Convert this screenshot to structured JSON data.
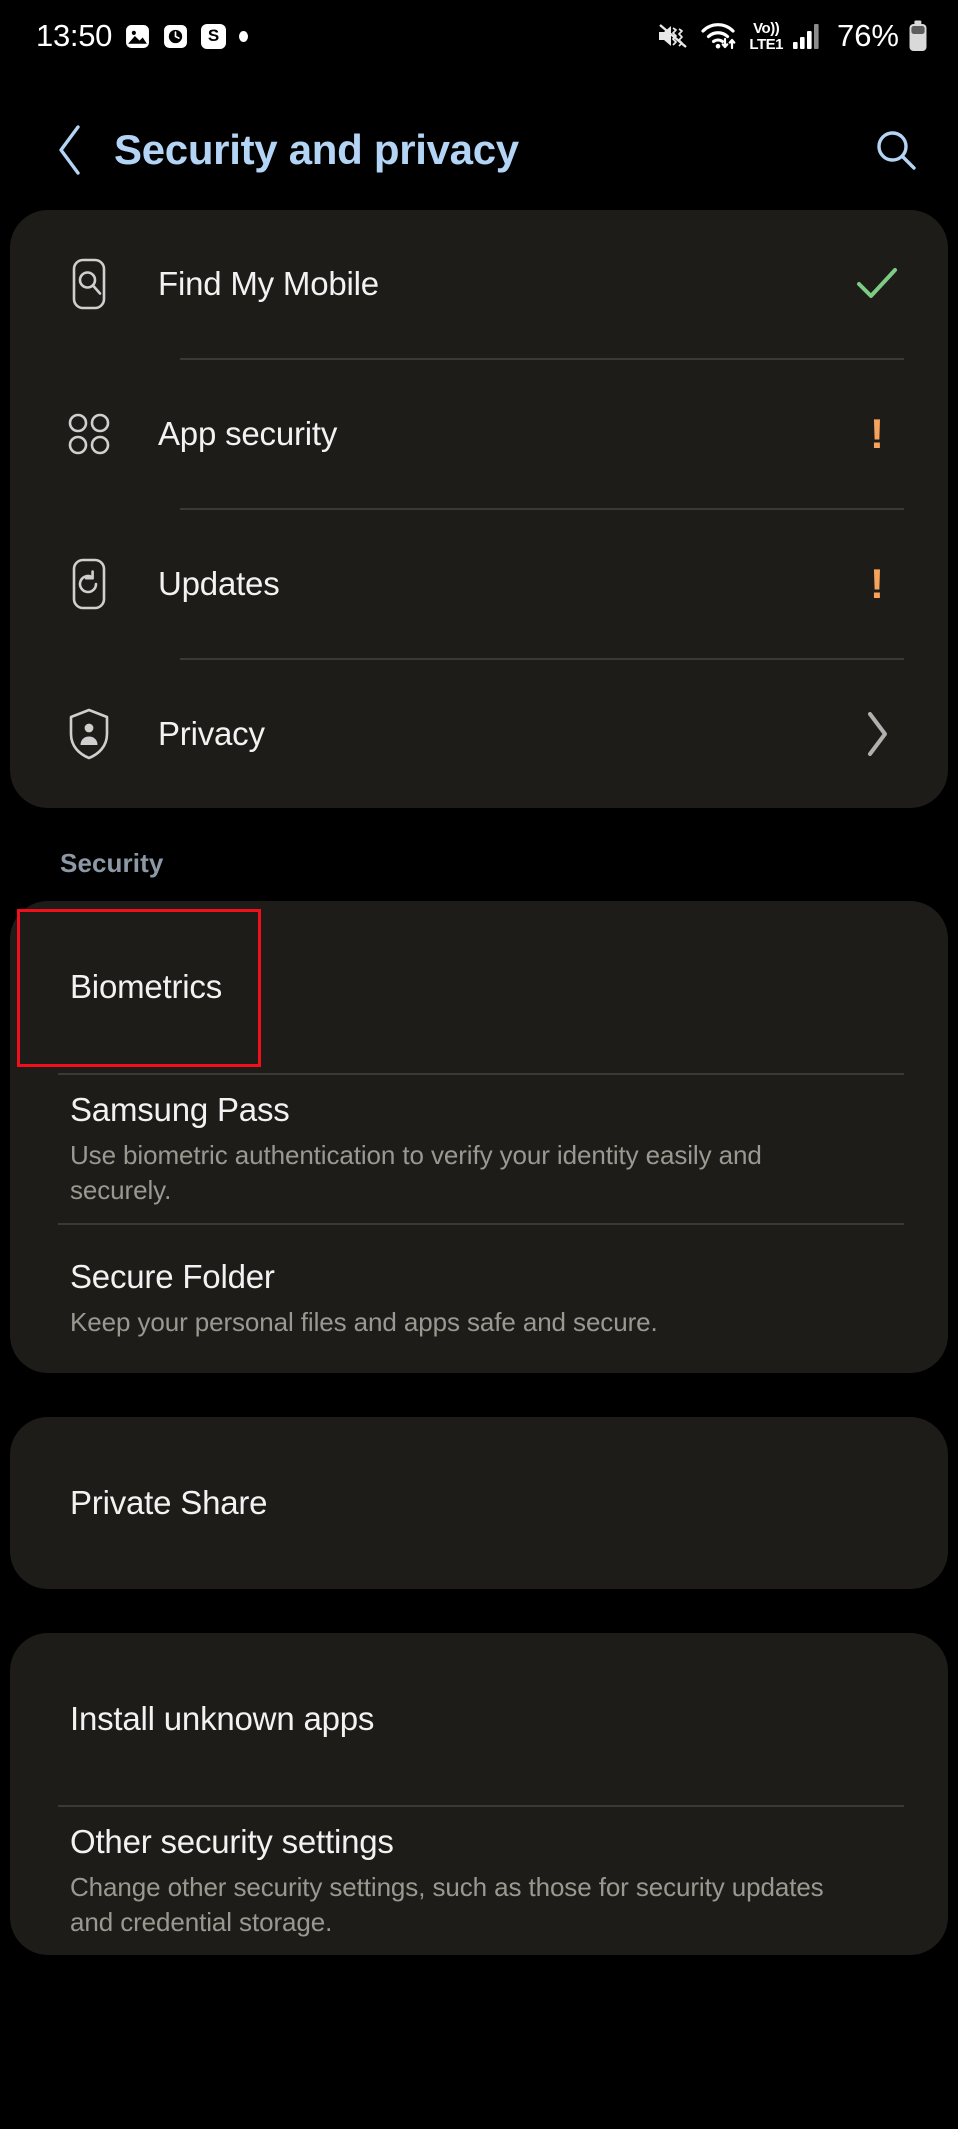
{
  "status_bar": {
    "time": "13:50",
    "notifications": [
      {
        "icon": "image-icon",
        "label": ""
      },
      {
        "icon": "clock-icon",
        "label": ""
      },
      {
        "icon": "samsung-s-icon",
        "label": "S"
      },
      {
        "icon": "dot-icon",
        "label": ""
      }
    ],
    "mute_icon": "mute-vibrate-icon",
    "wifi_icon": "wifi-data-transfer-icon",
    "volte": {
      "top": "Vo))",
      "bottom": "LTE1"
    },
    "signal_icon": "signal-bars-icon",
    "battery_percent": "76%",
    "battery_icon": "battery-icon"
  },
  "app_bar": {
    "back_icon": "back-chevron-icon",
    "title": "Security and privacy",
    "search_icon": "search-icon"
  },
  "cards": [
    {
      "id": "status-card",
      "rows": [
        {
          "icon": "find-my-mobile-icon",
          "title": "Find My Mobile",
          "subtitle": "",
          "end": "check",
          "end_icon": "green-check-icon"
        },
        {
          "icon": "app-security-icon",
          "title": "App security",
          "subtitle": "",
          "end": "alert",
          "end_icon": "orange-alert-icon",
          "alert_mark": "!"
        },
        {
          "icon": "updates-icon",
          "title": "Updates",
          "subtitle": "",
          "end": "alert",
          "end_icon": "orange-alert-icon",
          "alert_mark": "!"
        },
        {
          "icon": "privacy-shield-icon",
          "title": "Privacy",
          "subtitle": "",
          "end": "chevron",
          "end_icon": "chevron-right-icon"
        }
      ]
    }
  ],
  "security_section": {
    "label": "Security",
    "rows": [
      {
        "title": "Biometrics",
        "subtitle": "",
        "highlighted": true
      },
      {
        "title": "Samsung Pass",
        "subtitle": "Use biometric authentication to verify your identity easily and securely.",
        "highlighted": false
      },
      {
        "title": "Secure Folder",
        "subtitle": "Keep your personal files and apps safe and secure.",
        "highlighted": false
      }
    ]
  },
  "private_share_card": {
    "rows": [
      {
        "title": "Private Share",
        "subtitle": ""
      }
    ]
  },
  "install_card": {
    "rows": [
      {
        "title": "Install unknown apps",
        "subtitle": ""
      },
      {
        "title": "Other security settings",
        "subtitle": "Change other security settings, such as those for security updates and credential storage."
      }
    ]
  },
  "colors": {
    "background": "#000000",
    "card": "#1d1c19",
    "title_accent": "#b3d4f5",
    "section_label": "#8c98a6",
    "primary_text": "#f2f2f2",
    "secondary_text": "#9b9890",
    "check_green": "#7ecb84",
    "alert_orange": "#f5a25d",
    "annotation_red": "#f10f1c",
    "divider": "#3a3935"
  }
}
